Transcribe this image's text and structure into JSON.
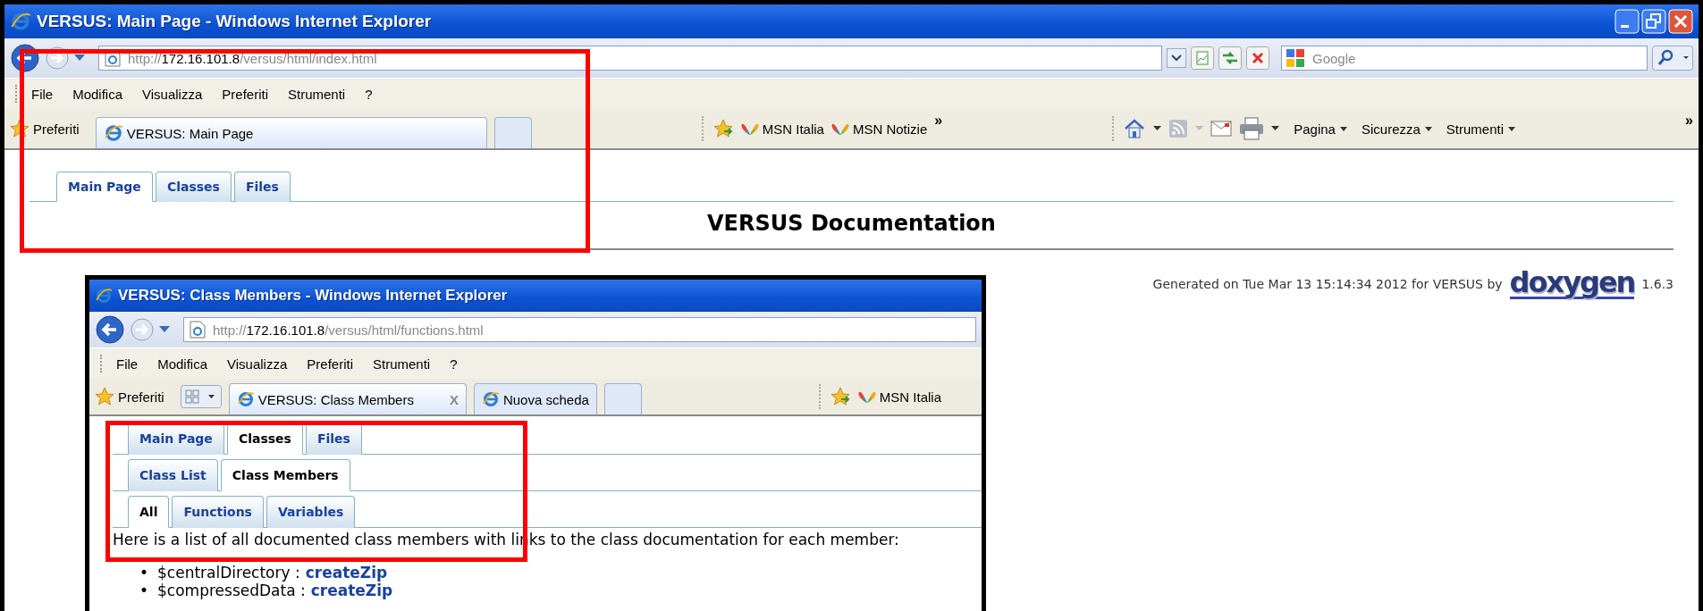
{
  "window": {
    "title": "VERSUS: Main Page - Windows Internet Explorer"
  },
  "address": {
    "scheme": "http://",
    "host": "172.16.101.8",
    "path": "/versus/html/index.html"
  },
  "search": {
    "placeholder": "Google"
  },
  "menu": [
    "File",
    "Modifica",
    "Visualizza",
    "Preferiti",
    "Strumenti",
    "?"
  ],
  "favorites": {
    "label": "Preferiti",
    "tabs": [
      {
        "label": "VERSUS: Main Page",
        "selected": true
      }
    ],
    "links": [
      "MSN Italia",
      "MSN Notizie"
    ],
    "overflow": "»"
  },
  "command_bar": {
    "items": [
      "Pagina",
      "Sicurezza",
      "Strumenti"
    ],
    "overflow": "»"
  },
  "page": {
    "tabs": [
      {
        "label": "Main Page",
        "selected": true
      },
      {
        "label": "Classes",
        "selected": false
      },
      {
        "label": "Files",
        "selected": false
      }
    ],
    "title": "VERSUS Documentation",
    "footer": {
      "text": "Generated on Tue Mar 13 15:14:34 2012 for VERSUS by",
      "logo": "doxygen",
      "version": "1.6.3"
    }
  },
  "inset_window": {
    "title": "VERSUS: Class Members - Windows Internet Explorer",
    "address": {
      "scheme": "http://",
      "host": "172.16.101.8",
      "path": "/versus/html/functions.html"
    },
    "menu": [
      "File",
      "Modifica",
      "Visualizza",
      "Preferiti",
      "Strumenti",
      "?"
    ],
    "favorites": {
      "label": "Preferiti",
      "tabs": [
        {
          "label": "VERSUS: Class Members",
          "selected": true,
          "close": "X"
        },
        {
          "label": "Nuova scheda",
          "selected": false
        }
      ],
      "links": [
        "MSN Italia"
      ]
    },
    "tab_rows": [
      [
        {
          "label": "Main Page",
          "selected": false
        },
        {
          "label": "Classes",
          "selected": true
        },
        {
          "label": "Files",
          "selected": false
        }
      ],
      [
        {
          "label": "Class List",
          "selected": false
        },
        {
          "label": "Class Members",
          "selected": true
        }
      ],
      [
        {
          "label": "All",
          "selected": true
        },
        {
          "label": "Functions",
          "selected": false
        },
        {
          "label": "Variables",
          "selected": false
        }
      ]
    ],
    "intro": "Here is a list of all documented class members with links to the class documentation for each member:",
    "members": [
      {
        "bullet": "•",
        "name": "$centralDirectory :",
        "link": "createZip"
      },
      {
        "bullet": "•",
        "name": "$compressedData :",
        "link": "createZip"
      }
    ]
  }
}
